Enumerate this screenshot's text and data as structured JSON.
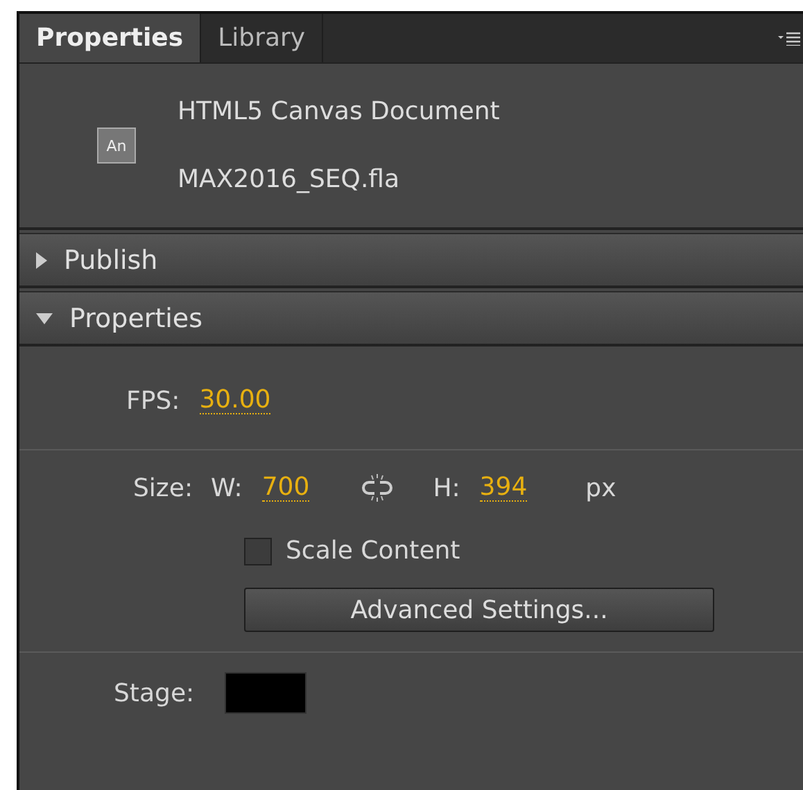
{
  "tabs": [
    {
      "label": "Properties",
      "selected": true
    },
    {
      "label": "Library",
      "selected": false
    }
  ],
  "document": {
    "type": "HTML5 Canvas Document",
    "file": "MAX2016_SEQ.fla",
    "badge": "An"
  },
  "sections": [
    {
      "title": "Publish",
      "expanded": false
    },
    {
      "title": "Properties",
      "expanded": true
    }
  ],
  "fps": {
    "label": "FPS:",
    "value": "30.00"
  },
  "size": {
    "label": "Size:",
    "w_label": "W:",
    "w_value": "700",
    "h_label": "H:",
    "h_value": "394",
    "unit": "px",
    "linked": false
  },
  "scale_content": {
    "label": "Scale Content",
    "checked": false
  },
  "advanced_button": "Advanced Settings...",
  "stage": {
    "label": "Stage:",
    "color": "#000000"
  }
}
